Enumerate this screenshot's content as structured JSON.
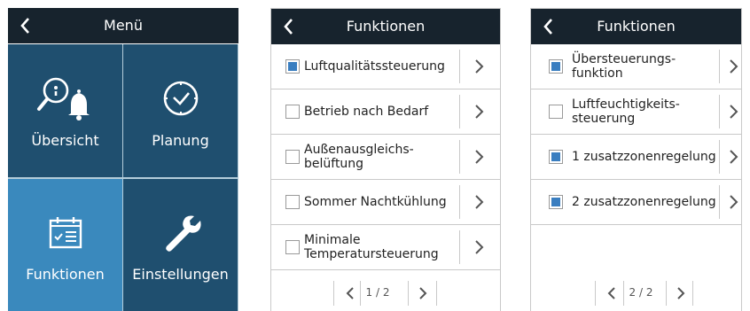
{
  "screen_menu": {
    "title": "Menü",
    "tiles": [
      {
        "label": "Übersicht",
        "icon": "overview-icon"
      },
      {
        "label": "Planung",
        "icon": "clock-icon"
      },
      {
        "label": "Funktionen",
        "icon": "calendar-list-icon"
      },
      {
        "label": "Einstellungen",
        "icon": "wrench-icon"
      }
    ],
    "selected_tile": "Funktionen"
  },
  "screen_functions_p1": {
    "title": "Funktionen",
    "items": [
      {
        "label": "Luftqualitätssteuerung",
        "checked": true
      },
      {
        "label": "Betrieb nach Bedarf",
        "checked": false
      },
      {
        "label": "Außenausgleichs-\nbelüftung",
        "checked": false
      },
      {
        "label": "Sommer Nachtkühlung",
        "checked": false
      },
      {
        "label": "Minimale\nTemperatursteuerung",
        "checked": false
      }
    ],
    "page": "1 / 2"
  },
  "screen_functions_p2": {
    "title": "Funktionen",
    "items": [
      {
        "label": "Übersteuerungs-\nfunktion",
        "checked": true
      },
      {
        "label": "Luftfeuchtigkeits-\nsteuerung",
        "checked": false
      },
      {
        "label": "1 zusatzzonenregelung",
        "checked": true
      },
      {
        "label": "2 zusatzzonenregelung",
        "checked": true
      }
    ],
    "page": "2 / 2"
  },
  "colors": {
    "header_bg": "#17232d",
    "tile_bg": "#1f4f6f",
    "tile_selected_bg": "#3a89bd",
    "checkbox_fill": "#3a7ec0"
  }
}
